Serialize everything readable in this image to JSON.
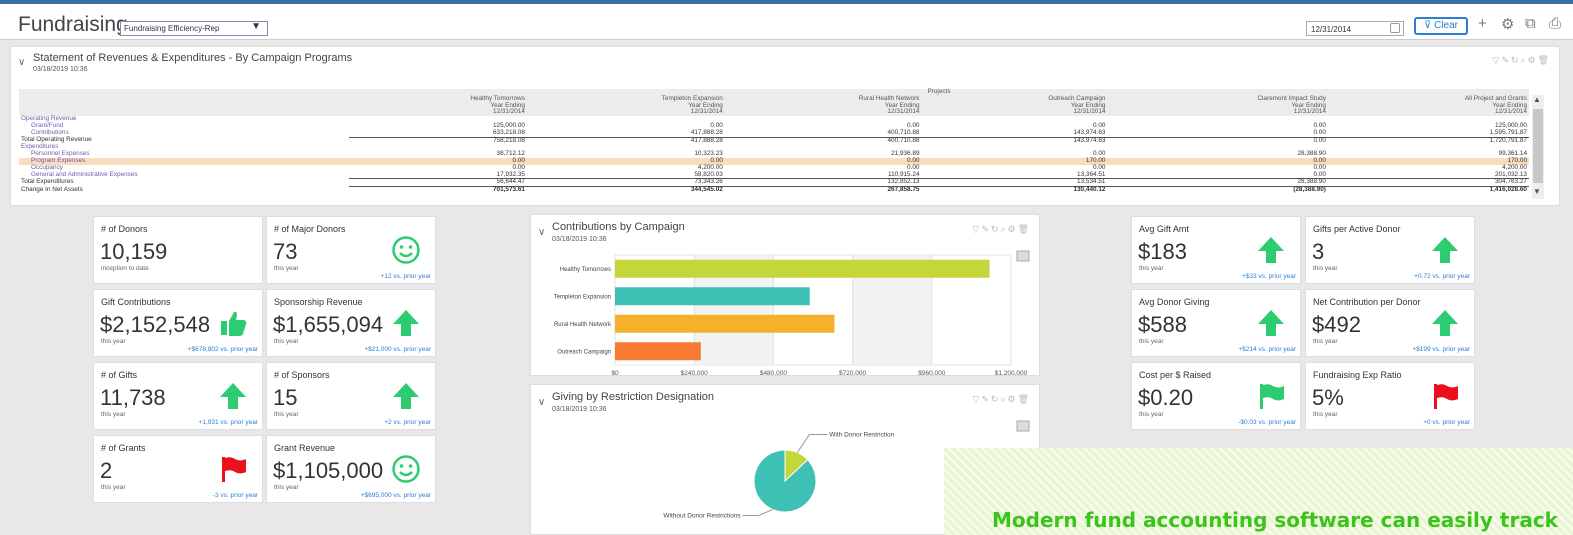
{
  "header": {
    "title": "Fundraising",
    "view_select": "Fundraising Efficiency-Rep",
    "date": "12/31/2014",
    "clear_label": "Clear"
  },
  "statement": {
    "title": "Statement of Revenues & Expenditures - By Campaign Programs",
    "timestamp": "03/18/2019 10:36",
    "projects_label": "Projects",
    "columns": [
      {
        "name": "Healthy Tomorrows",
        "sub": "Year Ending",
        "date": "12/31/2014"
      },
      {
        "name": "Templeton Expansion",
        "sub": "Year Ending",
        "date": "12/31/2014"
      },
      {
        "name": "Rural Health Network",
        "sub": "Year Ending",
        "date": "12/31/2014"
      },
      {
        "name": "Outreach Campaign",
        "sub": "Year Ending",
        "date": "12/31/2014"
      },
      {
        "name": "Claremont Impact Study",
        "sub": "Year Ending",
        "date": "12/31/2014"
      },
      {
        "name": "All Project and Grants",
        "sub": "Year Ending",
        "date": "12/31/2014"
      }
    ],
    "rows": [
      {
        "label": "Operating Revenue",
        "kind": "section",
        "values": []
      },
      {
        "label": "Grant/Fund",
        "kind": "item",
        "values": [
          "125,000.00",
          "0.00",
          "0.00",
          "0.00",
          "0.00",
          "125,000.00"
        ]
      },
      {
        "label": "Contributions",
        "kind": "item",
        "values": [
          "633,218.08",
          "417,888.28",
          "400,710.88",
          "143,974.63",
          "0.00",
          "1,595,791.87"
        ]
      },
      {
        "label": "Total Operating Revenue",
        "kind": "total",
        "values": [
          "758,218.08",
          "417,888.28",
          "400,710.88",
          "143,974.63",
          "0.00",
          "1,720,791.87"
        ]
      },
      {
        "label": "Expenditures",
        "kind": "section",
        "values": []
      },
      {
        "label": "Personnel Expenses",
        "kind": "item",
        "values": [
          "38,712.12",
          "10,323.23",
          "21,936.89",
          "0.00",
          "28,388.90",
          "99,361.14"
        ]
      },
      {
        "label": "Program Expenses",
        "kind": "highlight",
        "values": [
          "0.00",
          "0.00",
          "0.00",
          "170.00",
          "0.00",
          "170.00"
        ]
      },
      {
        "label": "Occupancy",
        "kind": "item",
        "values": [
          "0.00",
          "4,200.00",
          "0.00",
          "0.00",
          "0.00",
          "4,200.00"
        ]
      },
      {
        "label": "General and Administrative Expenses",
        "kind": "item",
        "values": [
          "17,932.35",
          "58,820.03",
          "110,915.24",
          "13,364.51",
          "0.00",
          "201,032.13"
        ]
      },
      {
        "label": "Total Expenditures",
        "kind": "total",
        "values": [
          "56,644.47",
          "73,343.26",
          "132,852.13",
          "13,534.51",
          "28,388.90",
          "304,763.27"
        ]
      },
      {
        "label": "Change In Net Assets",
        "kind": "net",
        "values": [
          "701,573.61",
          "344,545.02",
          "267,858.75",
          "130,440.12",
          "(28,388.90)",
          "1,416,028.60"
        ]
      }
    ]
  },
  "kpis": [
    {
      "label": "# of Donors",
      "value": "10,159",
      "period": "inception to date",
      "compare": "",
      "icon": "none"
    },
    {
      "label": "# of Major Donors",
      "value": "73",
      "period": "this year",
      "compare": "+12 vs. prior year",
      "icon": "smiley-icon"
    },
    {
      "label": "Gift Contributions",
      "value": "$2,152,548",
      "period": "this year",
      "compare": "+$678,802 vs. prior year",
      "icon": "thumbs-up-icon"
    },
    {
      "label": "Sponsorship Revenue",
      "value": "$1,655,094",
      "period": "this year",
      "compare": "+$21,000 vs. prior year",
      "icon": "arrow-up-icon"
    },
    {
      "label": "# of Gifts",
      "value": "11,738",
      "period": "this year",
      "compare": "+1,931 vs. prior year",
      "icon": "arrow-up-icon"
    },
    {
      "label": "# of Sponsors",
      "value": "15",
      "period": "this year",
      "compare": "+2 vs. prior year",
      "icon": "arrow-up-icon"
    },
    {
      "label": "# of Grants",
      "value": "2",
      "period": "this year",
      "compare": "-3 vs. prior year",
      "icon": "red-flag-icon"
    },
    {
      "label": "Grant Revenue",
      "value": "$1,105,000",
      "period": "this year",
      "compare": "+$695,000 vs. prior year",
      "icon": "smiley-icon"
    },
    {
      "label": "Avg Gift Amt",
      "value": "$183",
      "period": "this year",
      "compare": "+$33 vs. prior year",
      "icon": "arrow-up-icon"
    },
    {
      "label": "Gifts per Active Donor",
      "value": "3",
      "period": "this year",
      "compare": "+0.72 vs. prior year",
      "icon": "arrow-up-icon"
    },
    {
      "label": "Avg Donor Giving",
      "value": "$588",
      "period": "this year",
      "compare": "+$214 vs. prior year",
      "icon": "arrow-up-icon"
    },
    {
      "label": "Net Contribution per Donor",
      "value": "$492",
      "period": "this year",
      "compare": "+$199 vs. prior year",
      "icon": "arrow-up-icon"
    },
    {
      "label": "Cost per $ Raised",
      "value": "$0.20",
      "period": "this year",
      "compare": "-$0.03 vs. prior year",
      "icon": "green-flag-icon"
    },
    {
      "label": "Fundraising Exp Ratio",
      "value": "5%",
      "period": "this year",
      "compare": "+0 vs. prior year",
      "icon": "red-flag-icon"
    }
  ],
  "contrib_panel": {
    "title": "Contributions by Campaign",
    "timestamp": "03/18/2019 10:36"
  },
  "restrict_panel": {
    "title": "Giving by Restriction Designation",
    "timestamp": "03/18/2019 10:36"
  },
  "chart_data": [
    {
      "type": "bar",
      "orientation": "horizontal",
      "categories": [
        "Healthy Tomorrows",
        "Templeton Expansion",
        "Rural Health Network",
        "Outreach Campaign"
      ],
      "values": [
        1135000,
        590000,
        665000,
        260000
      ],
      "colors": [
        "#c4d63a",
        "#3fc0b4",
        "#f5b02e",
        "#f77a35"
      ],
      "xlim": [
        0,
        1200000
      ],
      "xticks": [
        "$0",
        "$240,000",
        "$480,000",
        "$720,000",
        "$960,000",
        "$1,200,000"
      ],
      "grid": true
    },
    {
      "type": "pie",
      "labels": [
        "With Donor Restriction",
        "Without Donor Restrictions"
      ],
      "values": [
        0.13,
        0.87
      ],
      "colors": [
        "#c4d63a",
        "#3fc0b4"
      ]
    }
  ],
  "caption": "Modern fund accounting software can easily track",
  "colors": {
    "accent": "#2b7fd1",
    "green": "#2ecc71",
    "red": "#e8111c",
    "caption_green": "#3bc41c"
  }
}
